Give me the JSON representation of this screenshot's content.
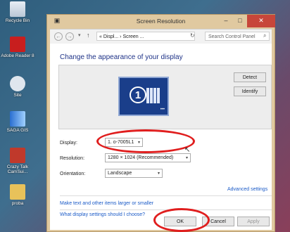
{
  "desktop": {
    "icons": [
      {
        "label": "Recycle Bin",
        "icon": "recycle-bin-icon"
      },
      {
        "label": "Adobe Reader 8",
        "icon": "adobe-reader-icon"
      },
      {
        "label": "Site",
        "icon": "site-icon"
      },
      {
        "label": "SAGA GIS",
        "icon": "saga-gis-icon"
      },
      {
        "label": "Crazy Talk CamSui...",
        "icon": "crazytalk-icon"
      },
      {
        "label": "proba",
        "icon": "folder-icon"
      }
    ]
  },
  "window": {
    "title": "Screen Resolution",
    "controls": {
      "minimize": "–",
      "maximize": "□",
      "close": "✕"
    },
    "address": {
      "breadcrumb": "« Displ... › Screen ...",
      "search_placeholder": "Search Control Panel"
    },
    "heading": "Change the appearance of your display",
    "monitor_number": "1",
    "buttons": {
      "detect": "Detect",
      "identify": "Identify"
    },
    "fields": {
      "display_label": "Display:",
      "display_value": "1. o-7005L1",
      "resolution_label": "Resolution:",
      "resolution_value": "1280 × 1024 (Recommended)",
      "orientation_label": "Orientation:",
      "orientation_value": "Landscape"
    },
    "links": {
      "advanced": "Advanced settings",
      "text_size": "Make text and other items larger or smaller",
      "which_settings": "What display settings should I choose?"
    },
    "footer": {
      "ok": "OK",
      "cancel": "Cancel",
      "apply": "Apply"
    }
  },
  "colors": {
    "annotation": "#e01e1e",
    "heading": "#1e3287",
    "link": "#1a5ac7"
  }
}
